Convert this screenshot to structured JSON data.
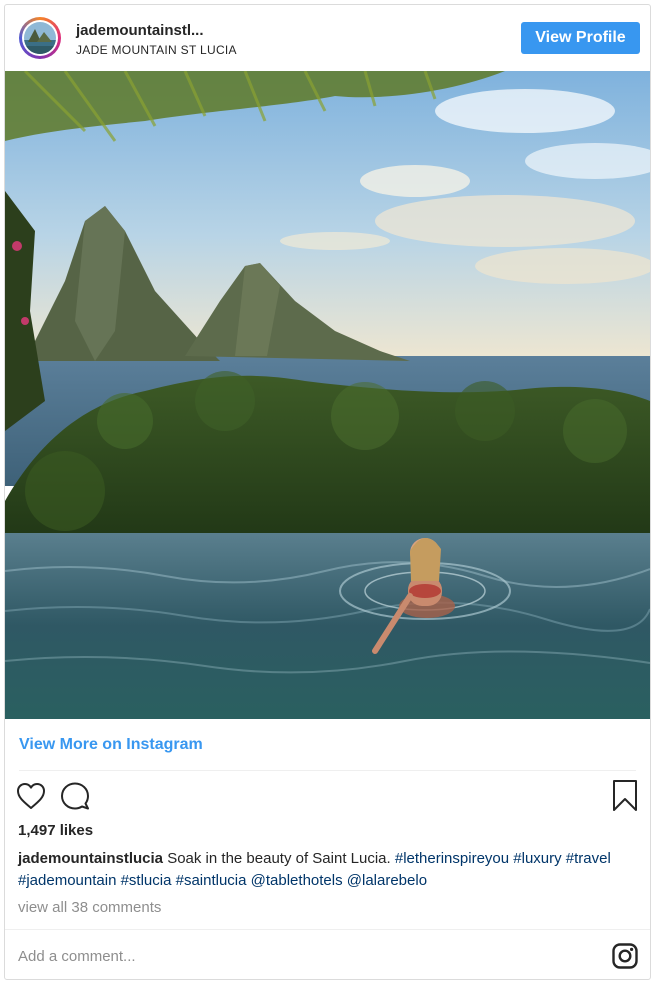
{
  "header": {
    "username": "jademountainstl...",
    "location": "JADE MOUNTAIN ST LUCIA",
    "view_profile_label": "View Profile"
  },
  "post": {
    "image_alt": "Jade Mountain infinity pool overlooking the Pitons",
    "view_more_label": "View More on Instagram",
    "likes": "1,497 likes",
    "caption_user": "jademountainstlucia",
    "caption_text": " Soak in the beauty of Saint Lucia. ",
    "caption_tags": "#letherinspireyou #luxury #travel #jademountain #stlucia #saintlucia @tablethotels @lalarebelo",
    "view_comments": "view all 38 comments",
    "comment_placeholder": "Add a comment..."
  },
  "icons": {
    "like": "heart-icon",
    "comment": "comment-bubble-icon",
    "save": "bookmark-icon",
    "brand": "instagram-logo-icon"
  },
  "colors": {
    "accent": "#3897f0",
    "hashtag": "#003569",
    "muted": "#8e8e8e",
    "border": "#dbdbdb"
  }
}
